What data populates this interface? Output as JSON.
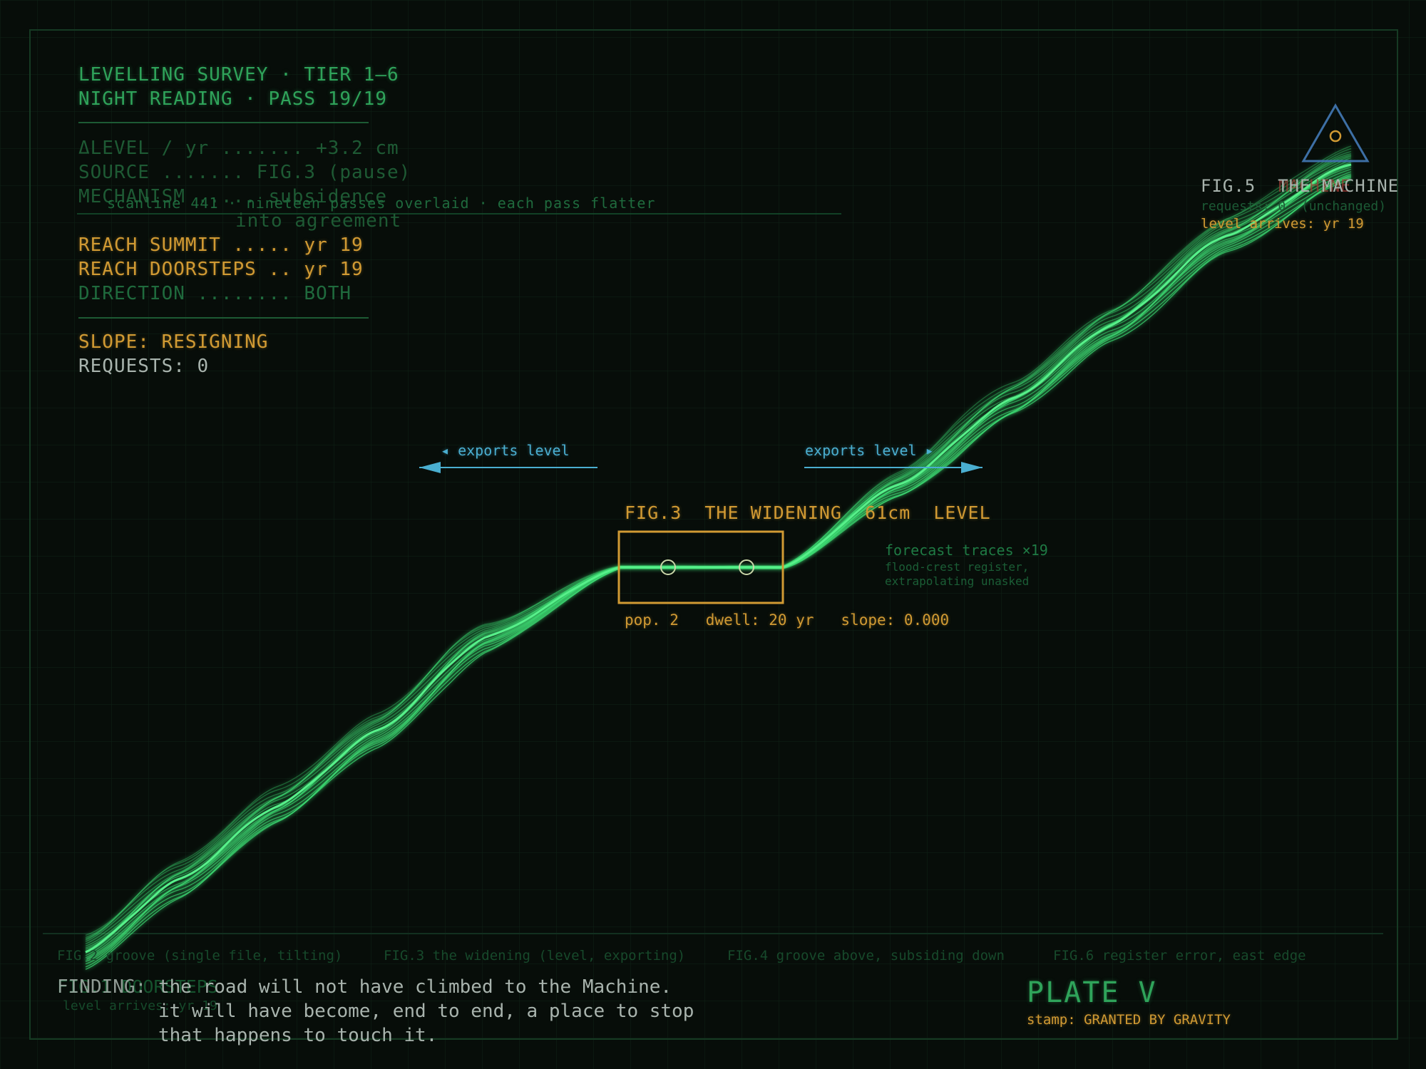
{
  "hud": {
    "title_line1": "LEVELLING SURVEY · TIER 1–6",
    "title_line2": "NIGHT READING · PASS 19/19",
    "delta_level": "ΔLEVEL / yr ....... +3.2 cm",
    "source": "SOURCE ....... FIG.3 (pause)",
    "mechanism_line1": "MECHANISM ..... subsidence",
    "mechanism_line2": "into agreement",
    "reach_summit": "REACH SUMMIT ..... yr 19",
    "reach_doorsteps": "REACH DOORSTEPS .. yr 19",
    "direction": "DIRECTION ........ BOTH",
    "slope_status": "SLOPE: RESIGNING",
    "requests": "REQUESTS: 0"
  },
  "scanline_note": "scanline 441 · nineteen passes overlaid · each pass flatter",
  "fig3": {
    "title": "FIG.3  THE WIDENING  61cm  LEVEL",
    "stats": "pop. 2   dwell: 20 yr   slope: 0.000",
    "exports_left": "◂ exports level",
    "exports_right": "exports level ▸"
  },
  "forecast": {
    "title": "forecast traces ×19",
    "line1": "flood-crest register,",
    "line2": "extrapolating unasked"
  },
  "fig5": {
    "title": "FIG.5  THE MACHINE",
    "ghost_title": "MACHINE",
    "requests": "requests: 0  (unchanged)",
    "level_arrives": "level arrives: yr 19"
  },
  "legend": {
    "fig2": "FIG.2 groove (single file, tilting)",
    "fig3": "FIG.3 the widening (level, exporting)",
    "fig4": "FIG.4 groove above, subsiding down",
    "fig6": "FIG.6 register error, east edge"
  },
  "finding": {
    "label": "FINDING:",
    "line1": "the road will not have climbed to the Machine.",
    "line2": "it will have become, end to end, a place to stop",
    "line3": "that happens to touch it.",
    "ghost_label": "FIG.1 DOORSTEPS",
    "ghost_sub": "level arrives: yr 19"
  },
  "plate": {
    "title": "PLATE V",
    "stamp": "stamp: GRANTED BY GRAVITY"
  },
  "colors": {
    "background": "#070d09",
    "trace_green": "#3ddc73",
    "hud_green": "#2fa35a",
    "amber": "#d19a33",
    "cyan": "#4aaed0"
  }
}
